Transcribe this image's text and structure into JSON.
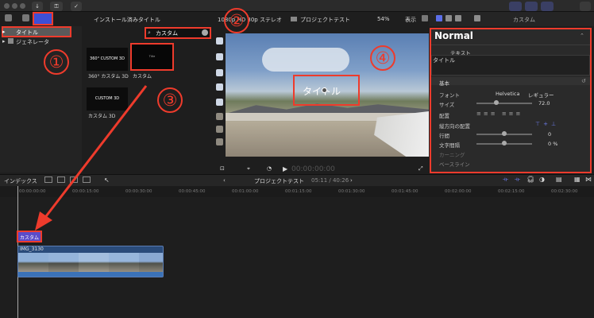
{
  "toolbar": {
    "bg": "#2a2a2a"
  },
  "browser": {
    "sidebar": [
      {
        "label": "タイトル",
        "selected": true
      },
      {
        "label": "ジェネレータ",
        "selected": false
      }
    ],
    "header": "インストール済みタイトル",
    "search_value": "カスタム",
    "thumbs": [
      {
        "caption": "360° カスタム 3D",
        "art": "360° CUSTOM 3D"
      },
      {
        "caption": "カスタム",
        "art": "Title"
      },
      {
        "caption": "カスタム 3D",
        "art": "CUSTOM 3D"
      }
    ]
  },
  "viewer": {
    "format": "1080p HD 30p ステレオ",
    "project": "プロジェクトテスト",
    "zoom": "54%",
    "view": "表示",
    "overlay_text": "タイトル",
    "timecode": "00:00:00:00"
  },
  "inspector": {
    "tab_title": "カスタム",
    "preset": "Normal",
    "text_section": "テキスト",
    "text_value": "タイトル",
    "basic_section": "基本",
    "rows": {
      "font_label": "フォント",
      "font_value": "Helvetica",
      "weight_value": "レギュラー",
      "size_label": "サイズ",
      "size_value": "72.0",
      "align_label": "配置",
      "vertical_label": "縦方向の配置",
      "line_spacing_label": "行間",
      "line_spacing_value": "0",
      "tracking_label": "文字間隔",
      "tracking_value": "0 %",
      "kerning_label": "カーニング",
      "baseline_label": "ベースライン"
    }
  },
  "timeline": {
    "index_label": "インデックス",
    "project_label": "プロジェクトテスト",
    "duration": "05:11 / 40:26",
    "ticks": [
      "00:00:00:00",
      "00:00:15:00",
      "00:00:30:00",
      "00:00:45:00",
      "00:01:00:00",
      "00:01:15:00",
      "00:01:30:00",
      "00:01:45:00",
      "00:02:00:00",
      "00:02:15:00",
      "00:02:30:00"
    ],
    "title_clip": "カスタム",
    "video_clip": "IMG_3130"
  },
  "annotations": [
    "①",
    "②",
    "③",
    "④"
  ],
  "accent": "#ee3b2c"
}
